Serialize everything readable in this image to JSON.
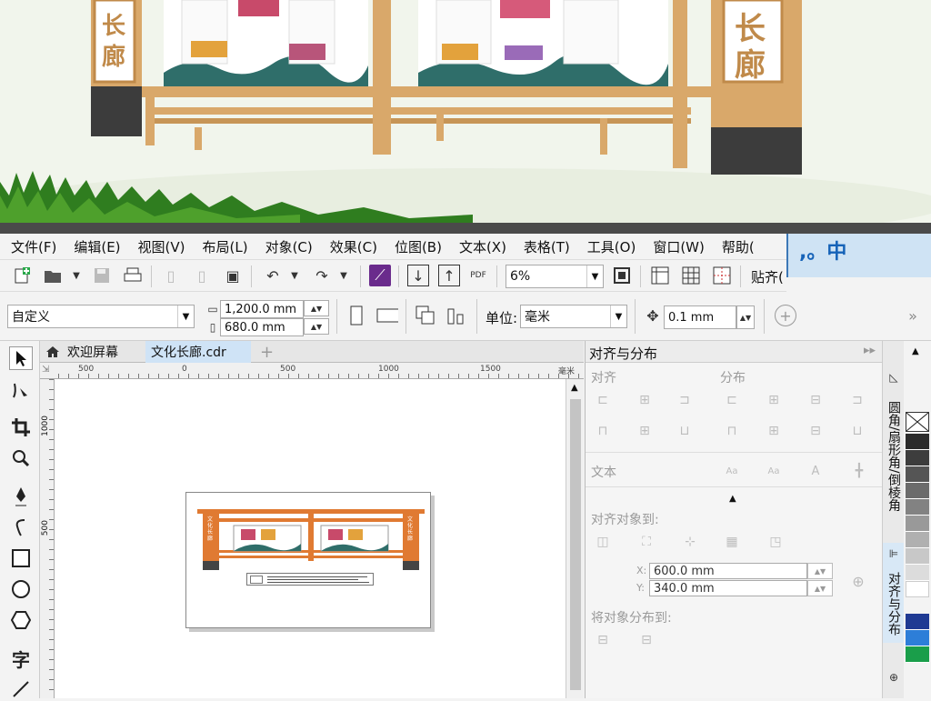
{
  "preview": {
    "sign_text": [
      "长",
      "廊"
    ]
  },
  "menubar": {
    "items": [
      "文件(F)",
      "编辑(E)",
      "视图(V)",
      "布局(L)",
      "对象(C)",
      "效果(C)",
      "位图(B)",
      "文本(X)",
      "表格(T)",
      "工具(O)",
      "窗口(W)",
      "帮助("
    ]
  },
  "ime": {
    "label": ",。中"
  },
  "toolbar": {
    "zoom_value": "6%",
    "snap_label": "贴齐("
  },
  "propbar": {
    "preset_value": "自定义",
    "width_value": "1,200.0 mm",
    "height_value": "680.0 mm",
    "unit_label": "单位:",
    "unit_value": "毫米",
    "nudge_value": "0.1 mm"
  },
  "doc_tabs": {
    "welcome": "欢迎屏幕",
    "file": "文化长廊.cdr"
  },
  "ruler": {
    "ticks": [
      "500",
      "0",
      "500",
      "1000",
      "1500"
    ],
    "unit": "毫米"
  },
  "vruler": {
    "ticks": [
      "1000",
      "500"
    ]
  },
  "thumbnail": {
    "sign_left": "文化长廊",
    "sign_right": "文化长廊"
  },
  "panel": {
    "title": "对齐与分布",
    "align": "对齐",
    "distribute": "分布",
    "text": "文本",
    "align_to": "对齐对象到:",
    "x_label": "X:",
    "x_value": "600.0 mm",
    "y_label": "Y:",
    "y_value": "340.0 mm",
    "distribute_to": "将对象分布到:"
  },
  "side_tabs": {
    "tab1": "圆角/扇形角/倒棱角",
    "tab2": "对齐与分布"
  },
  "palette": {
    "colors": [
      "#2b2b2b",
      "#3d3d3d",
      "#555555",
      "#6b6b6b",
      "#828282",
      "#999999",
      "#b0b0b0",
      "#c8c8c8",
      "#dcdcdc",
      "#ffffff",
      "#1f3a93",
      "#2d7ed8",
      "#1a9e4a"
    ]
  }
}
